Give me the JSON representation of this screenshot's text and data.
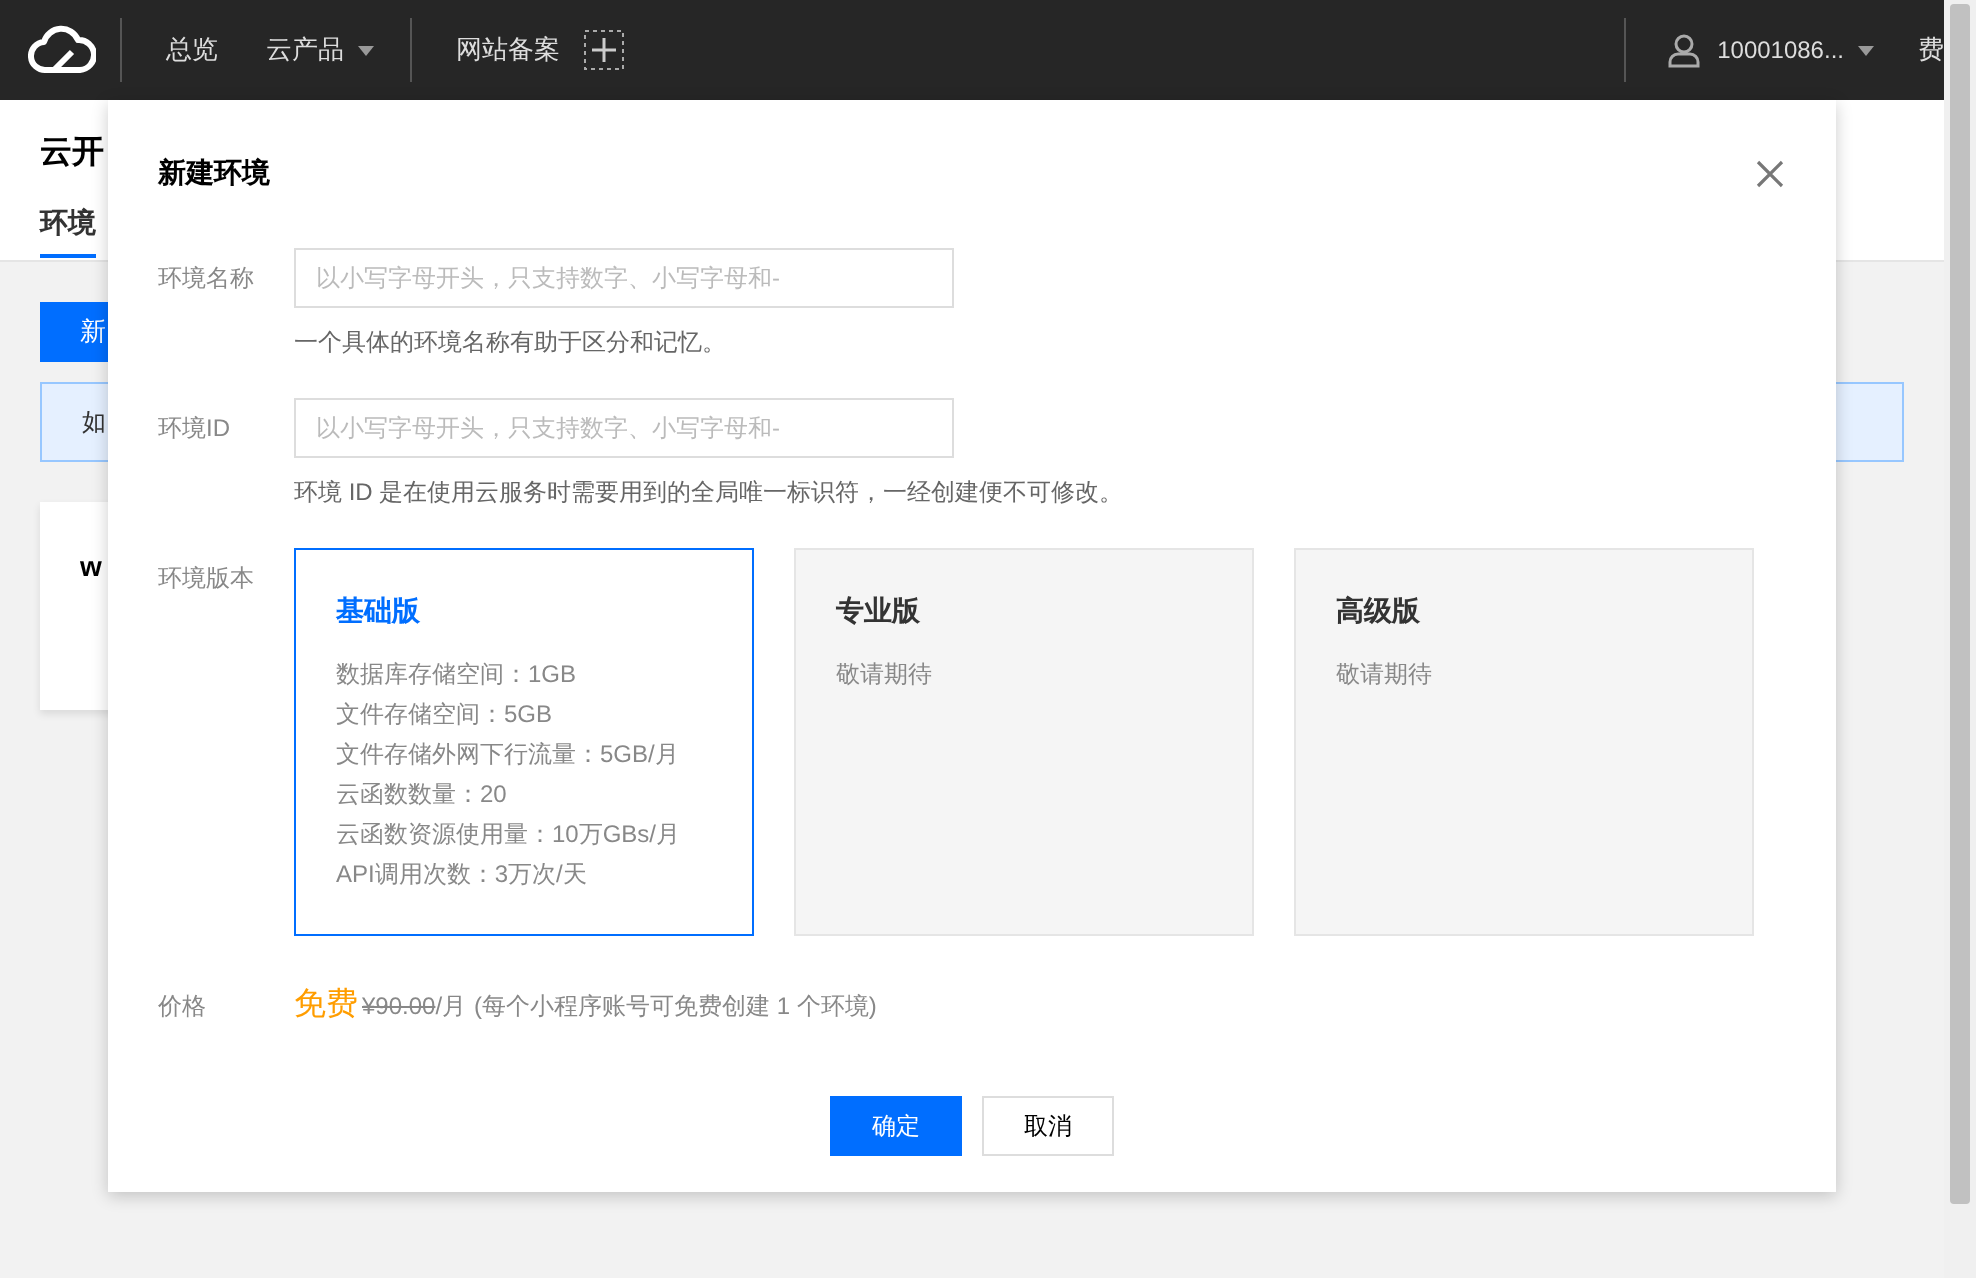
{
  "topbar": {
    "nav": [
      {
        "label": "总览",
        "dropdown": false
      },
      {
        "label": "云产品",
        "dropdown": true
      },
      {
        "label": "网站备案",
        "dropdown": false
      }
    ],
    "account": "10001086...",
    "right_cut": "费"
  },
  "page": {
    "title": "云开",
    "tabs": [
      {
        "label": "环境",
        "selected": true
      }
    ],
    "button": "新",
    "notice": "如",
    "card_title": "w"
  },
  "modal": {
    "title": "新建环境",
    "fields": [
      {
        "label": "环境名称",
        "placeholder": "以小写字母开头，只支持数字、小写字母和-",
        "hint": "一个具体的环境名称有助于区分和记忆。"
      },
      {
        "label": "环境ID",
        "placeholder": "以小写字母开头，只支持数字、小写字母和-",
        "hint": "环境 ID 是在使用云服务时需要用到的全局唯一标识符，一经创建便不可修改。"
      }
    ],
    "version_label": "环境版本",
    "versions": [
      {
        "name": "基础版",
        "selected": true,
        "lines": [
          "数据库存储空间：1GB",
          "文件存储空间：5GB",
          "文件存储外网下行流量：5GB/月",
          "云函数数量：20",
          "云函数资源使用量：10万GBs/月",
          "API调用次数：3万次/天"
        ]
      },
      {
        "name": "专业版",
        "selected": false,
        "lines": [
          "敬请期待"
        ]
      },
      {
        "name": "高级版",
        "selected": false,
        "lines": [
          "敬请期待"
        ]
      }
    ],
    "price": {
      "label": "价格",
      "free": "免费",
      "original": "¥90.00",
      "unit": "/月",
      "note": "(每个小程序账号可免费创建 1 个环境)"
    },
    "buttons": [
      {
        "label": "确定",
        "kind": "primary"
      },
      {
        "label": "取消",
        "kind": "default"
      }
    ]
  }
}
